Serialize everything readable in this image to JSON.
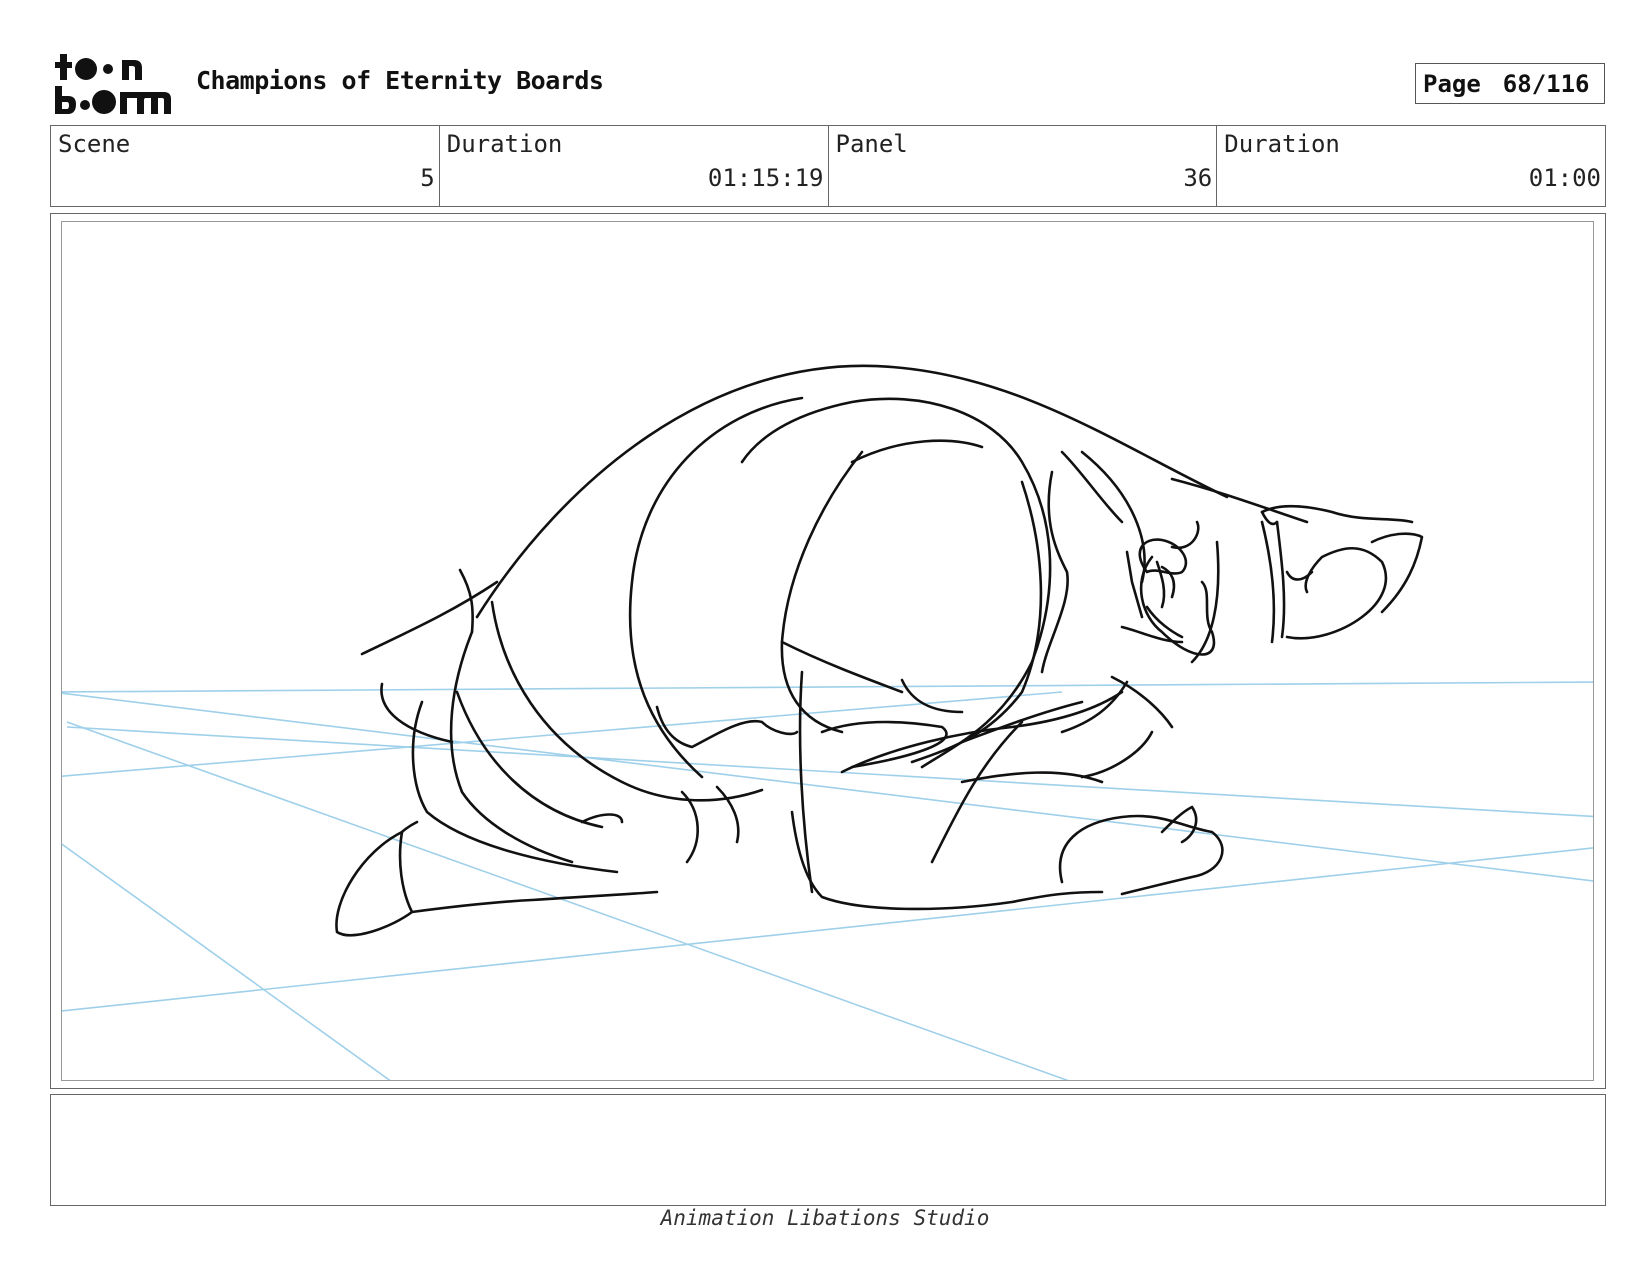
{
  "logo": {
    "line1": "toon",
    "line2": "boom",
    "icon": "toon-boom-logo"
  },
  "header": {
    "title": "Champions of Eternity Boards",
    "page_label": "Page",
    "page_value": "68/116"
  },
  "info": {
    "scene_label": "Scene",
    "scene_value": "5",
    "scene_duration_label": "Duration",
    "scene_duration_value": "01:15:19",
    "panel_label": "Panel",
    "panel_value": "36",
    "panel_duration_label": "Duration",
    "panel_duration_value": "01:00"
  },
  "panel": {
    "image": "rough pencil sketch of a crouching heavy-set figure on a floor with blue perspective guide lines",
    "guide_color": "#9fd0ea",
    "ink_color": "#111111"
  },
  "notes": {
    "text": ""
  },
  "footer": {
    "studio": "Animation Libations Studio"
  }
}
